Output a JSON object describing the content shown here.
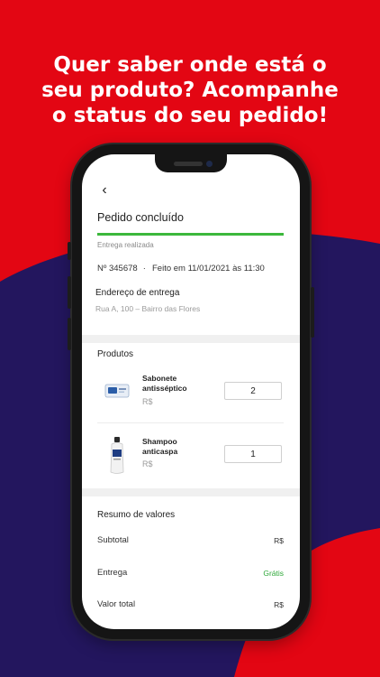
{
  "headline": {
    "line1": "Quer saber onde está o",
    "line2": "seu produto? Acompanhe",
    "line3": "o status do seu pedido!"
  },
  "colors": {
    "background": "#E30613",
    "wave": "#23165E",
    "progress": "#3CB83C",
    "free_label": "#2FA83A"
  },
  "screen": {
    "back_icon": "chevron-left-icon",
    "back_glyph": "‹",
    "order_status": "Pedido concluído",
    "progress_fraction": 1.0,
    "delivery_status": "Entrega realizada",
    "order_number": "Nº 345678",
    "separator": ".",
    "order_date": "Feito em 11/01/2021 às 11:30",
    "address": {
      "title": "Endereço de entrega",
      "value": "Rua A, 100 – Bairro das Flores"
    },
    "products": {
      "title": "Produtos",
      "items": [
        {
          "name": "Sabonete antisséptico",
          "price": "R$",
          "quantity": "2",
          "icon": "soap-product-icon"
        },
        {
          "name": "Shampoo anticaspa",
          "price": "R$",
          "quantity": "1",
          "icon": "shampoo-bottle-icon"
        }
      ]
    },
    "summary": {
      "title": "Resumo de valores",
      "subtotal_label": "Subtotal",
      "subtotal_value": "R$",
      "delivery_label": "Entrega",
      "delivery_value": "Grátis",
      "total_label": "Valor total",
      "total_value": "R$"
    }
  }
}
